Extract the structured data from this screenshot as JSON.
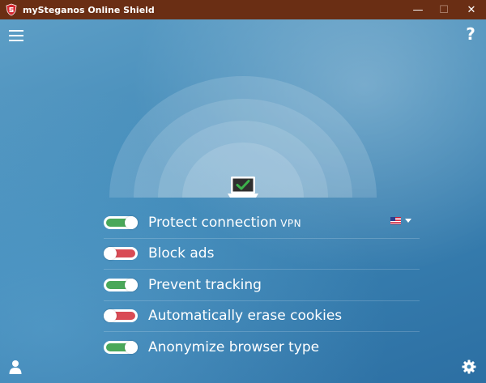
{
  "window": {
    "title": "mySteganos Online Shield",
    "controls": {
      "minimize": "—",
      "maximize": "☐",
      "close": "✕"
    },
    "titlebar_color": "#6a2e14"
  },
  "header": {
    "help_label": "?"
  },
  "status": {
    "connection_state": "protected"
  },
  "options": [
    {
      "label": "Protect connection",
      "suffix": "VPN",
      "enabled": true
    },
    {
      "label": "Block ads",
      "suffix": "",
      "enabled": false
    },
    {
      "label": "Prevent tracking",
      "suffix": "",
      "enabled": true
    },
    {
      "label": "Automatically erase cookies",
      "suffix": "",
      "enabled": false
    },
    {
      "label": "Anonymize browser type",
      "suffix": "",
      "enabled": true
    }
  ],
  "vpn_location": {
    "selected": "us-flag-icon"
  },
  "colors": {
    "toggle_on": "#4aa85a",
    "toggle_off": "#d94b55",
    "check_green": "#2f9e3c"
  },
  "icons": {
    "menu": "hamburger-menu-icon",
    "help": "question-mark-icon",
    "user": "user-icon",
    "settings": "gear-icon",
    "monitor": "monitor-check-icon"
  }
}
